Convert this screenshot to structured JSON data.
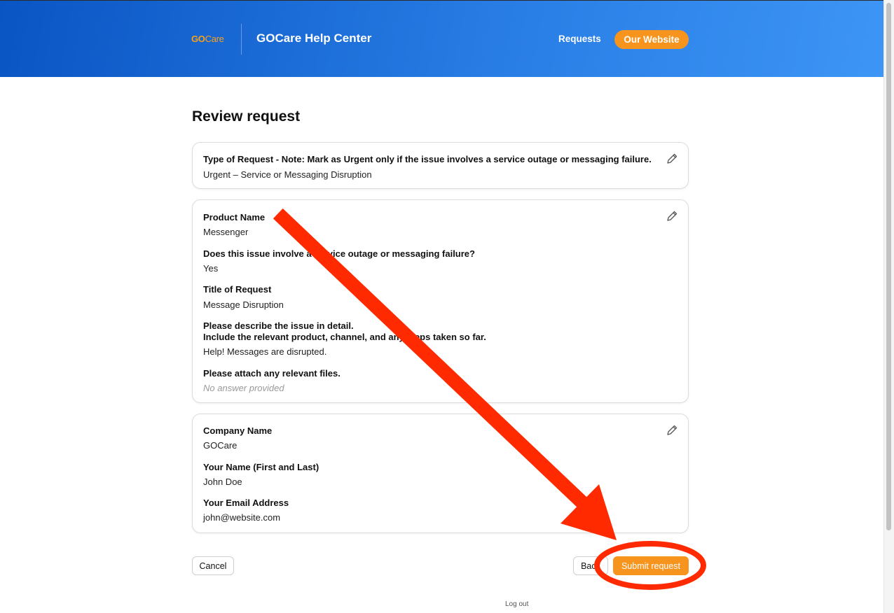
{
  "header": {
    "logo_go": "GO",
    "logo_care": "Care",
    "title": "GOCare Help Center",
    "nav_requests": "Requests",
    "nav_website": "Our Website"
  },
  "page": {
    "title": "Review request"
  },
  "cards": [
    {
      "fields": [
        {
          "label": "Type of Request - Note: Mark as Urgent only if the issue involves a service outage or messaging failure.",
          "value": "Urgent – Service or Messaging Disruption"
        }
      ]
    },
    {
      "fields": [
        {
          "label": "Product Name",
          "value": "Messenger"
        },
        {
          "label": "Does this issue involve a service outage or messaging failure?",
          "value": "Yes"
        },
        {
          "label": "Title of Request",
          "value": "Message Disruption"
        },
        {
          "label_line1": "Please describe the issue in detail.",
          "label_line2": "Include the relevant product, channel, and any steps taken so far.",
          "value": "Help! Messages are disrupted."
        },
        {
          "label": "Please attach any relevant files.",
          "value": "No answer provided"
        }
      ]
    },
    {
      "fields": [
        {
          "label": "Company Name",
          "value": "GOCare"
        },
        {
          "label": "Your Name (First and Last)",
          "value": "John Doe"
        },
        {
          "label": "Your Email Address",
          "value": "john@website.com"
        }
      ]
    }
  ],
  "actions": {
    "cancel": "Cancel",
    "back": "Back",
    "submit": "Submit request"
  },
  "footer": {
    "logout": "Log out"
  },
  "colors": {
    "accent_orange": "#f7941d",
    "header_blue": "#0a55c4",
    "annotation_red": "#ff2a00"
  }
}
